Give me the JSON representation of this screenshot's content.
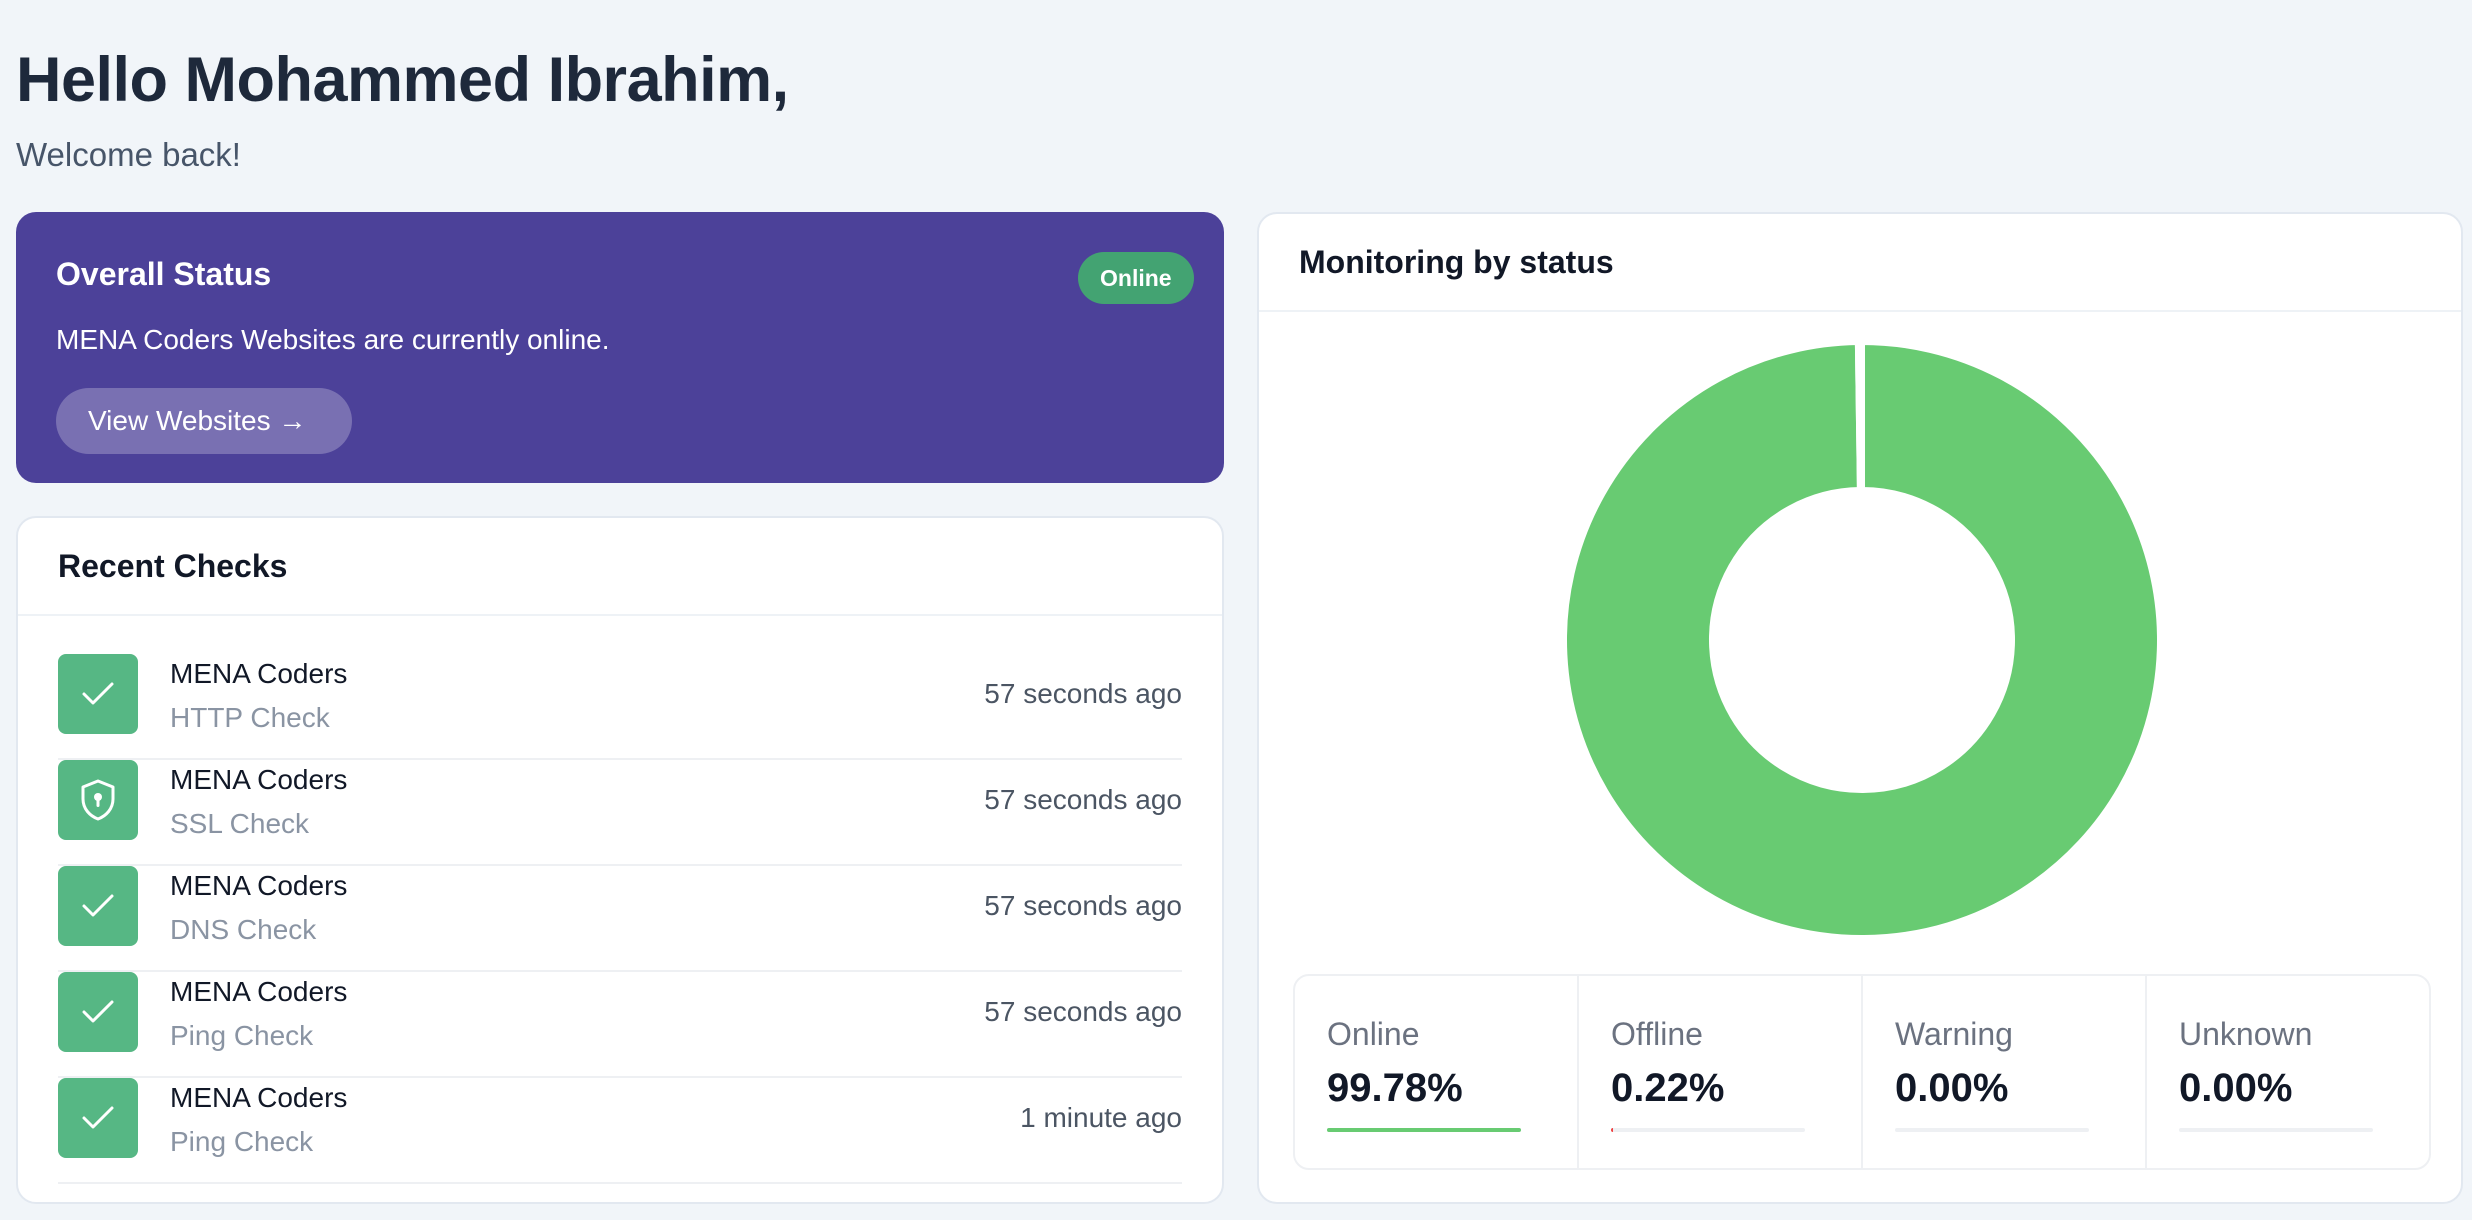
{
  "greeting": {
    "title": "Hello Mohammed Ibrahim,",
    "subtitle": "Welcome back!"
  },
  "overall_status": {
    "title": "Overall Status",
    "badge": "Online",
    "description": "MENA Coders Websites are currently online.",
    "button_label": "View Websites →"
  },
  "recent_checks": {
    "title": "Recent Checks",
    "items": [
      {
        "name": "MENA Coders",
        "type": "HTTP Check",
        "time": "57 seconds ago",
        "icon": "check-icon"
      },
      {
        "name": "MENA Coders",
        "type": "SSL Check",
        "time": "57 seconds ago",
        "icon": "shield-icon"
      },
      {
        "name": "MENA Coders",
        "type": "DNS Check",
        "time": "57 seconds ago",
        "icon": "check-icon"
      },
      {
        "name": "MENA Coders",
        "type": "Ping Check",
        "time": "57 seconds ago",
        "icon": "check-icon"
      },
      {
        "name": "MENA Coders",
        "type": "Ping Check",
        "time": "1 minute ago",
        "icon": "check-icon"
      }
    ]
  },
  "monitoring": {
    "title": "Monitoring by status",
    "stats": [
      {
        "label": "Online",
        "value": "99.78%",
        "fraction": 0.9978,
        "color": "#68cb72"
      },
      {
        "label": "Offline",
        "value": "0.22%",
        "fraction": 0.0022,
        "color": "#ef4444"
      },
      {
        "label": "Warning",
        "value": "0.00%",
        "fraction": 0.0,
        "color": "#f59e0b"
      },
      {
        "label": "Unknown",
        "value": "0.00%",
        "fraction": 0.0,
        "color": "#9ca3af"
      }
    ]
  },
  "chart_data": {
    "type": "pie",
    "categories": [
      "Online",
      "Offline",
      "Warning",
      "Unknown"
    ],
    "values": [
      99.78,
      0.22,
      0.0,
      0.0
    ],
    "colors": [
      "#68cb72",
      "#ef4444",
      "#f59e0b",
      "#9ca3af"
    ],
    "title": "Monitoring by status",
    "legend": "none"
  },
  "colors": {
    "accent_purple": "#4c4199",
    "success_green": "#56b784",
    "badge_green": "#43a372",
    "background": "#f1f5f9"
  }
}
